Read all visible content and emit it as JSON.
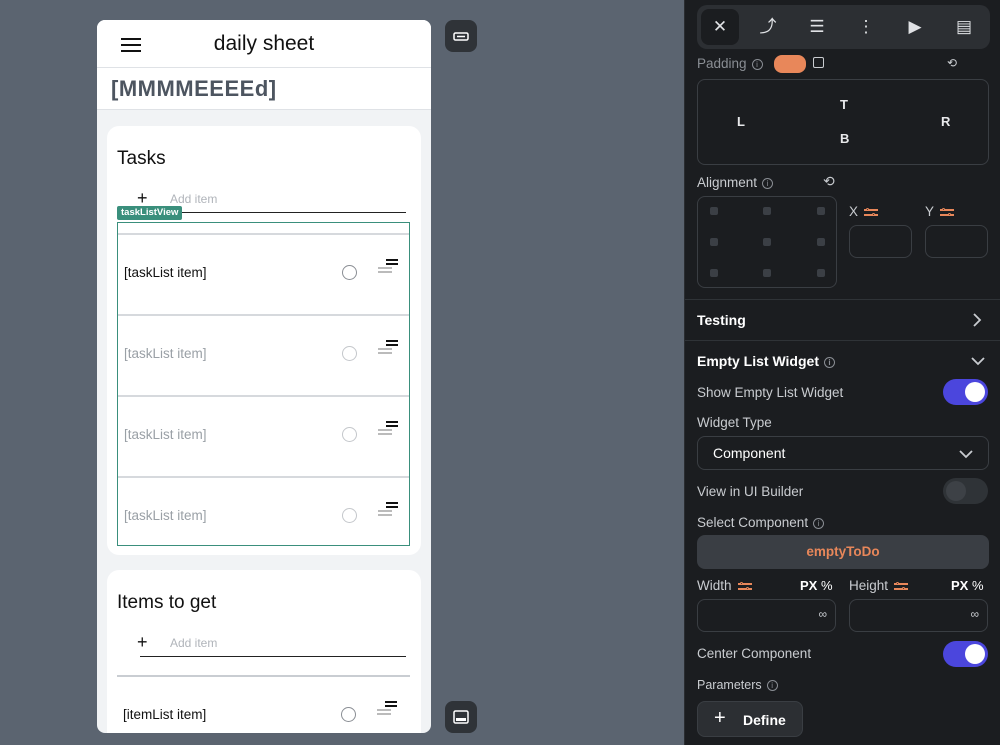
{
  "app": {
    "title": "daily sheet",
    "date_text": "[MMMMEEEEd]",
    "tasks_card": {
      "title": "Tasks",
      "add_placeholder": "Add item",
      "list_label": "taskListView",
      "items": [
        {
          "text": "[taskList item]",
          "color": "#111111"
        },
        {
          "text": "[taskList item]",
          "color": "#9aa0a6"
        },
        {
          "text": "[taskList item]",
          "color": "#9aa0a6"
        },
        {
          "text": "[taskList item]",
          "color": "#9aa0a6"
        }
      ]
    },
    "items_card": {
      "title": "Items to get",
      "add_placeholder": "Add item",
      "items": [
        {
          "text": "[itemList item]",
          "color": "#111111"
        }
      ]
    }
  },
  "panel": {
    "toolbar_icons": [
      "properties-icon",
      "actions-icon",
      "backend-query-icon",
      "layout-icon",
      "run-icon",
      "document-icon"
    ],
    "padding": {
      "label": "Padding",
      "top": "T",
      "left": "L",
      "bottom": "B",
      "right": "R"
    },
    "alignment": {
      "label": "Alignment",
      "x_label": "X",
      "y_label": "Y"
    },
    "testing": {
      "label": "Testing"
    },
    "empty_list": {
      "section_title": "Empty List Widget",
      "show_label": "Show Empty List Widget",
      "show_enabled": true,
      "widget_type_label": "Widget Type",
      "widget_type_value": "Component",
      "view_in_builder_label": "View in UI Builder",
      "view_in_builder_enabled": false,
      "select_component_label": "Select Component",
      "component_value": "emptyToDo",
      "width_label": "Width",
      "height_label": "Height",
      "unit_px": "PX",
      "unit_pct": "%",
      "width_value": "∞",
      "height_value": "∞",
      "center_label": "Center Component",
      "center_enabled": true,
      "parameters_label": "Parameters",
      "define_label": "Define"
    }
  },
  "colors": {
    "accent": "#4b46dd",
    "orange": "#e8875a",
    "list_border": "#3a8f7c"
  }
}
